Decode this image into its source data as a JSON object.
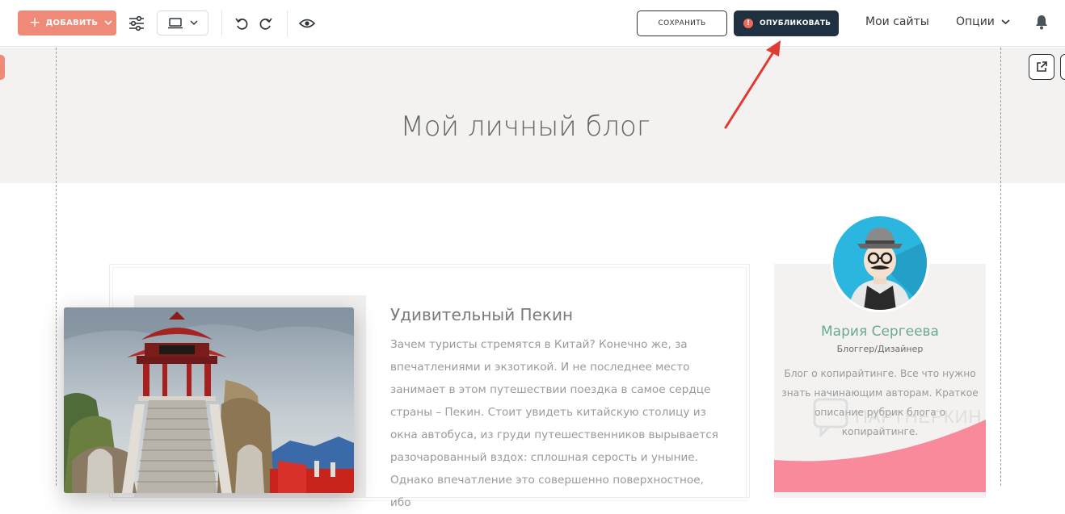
{
  "toolbar": {
    "add_label": "ДОБАВИТЬ",
    "save_label": "СОХРАНИТЬ",
    "publish_label": "ОПУБЛИКОВАТЬ",
    "my_sites_label": "Мои сайты",
    "options_label": "Опции"
  },
  "header": {
    "title": "Мой личный блог"
  },
  "post": {
    "title": "Удивительный Пекин",
    "text": "Зачем туристы стремятся в Китай? Конечно же, за впечатлениями и экзотикой. И не последнее место занимает в этом путешествии поездка в самое сердце страны – Пекин. Стоит увидеть китайскую столицу из окна автобуса, из груди путешественников вырывается разочарованный вздох: сплошная серость и уныние. Однако впечатление это совершенно поверхностное, ибо"
  },
  "author": {
    "name": "Мария Сергеева",
    "role": "Блоггер/Дизайнер",
    "description": "Блог о копирайтинге. Все что нужно знать начинающим авторам. Краткое описание рубрик блога о копирайтинге."
  },
  "watermark": {
    "text": "ПАРТНЕРКИН"
  },
  "colors": {
    "accent": "#ef8a78",
    "publish_bg": "#1f3040",
    "author_name": "#6aaa90",
    "pink": "#f98a9b",
    "arrow": "#e03a32"
  }
}
